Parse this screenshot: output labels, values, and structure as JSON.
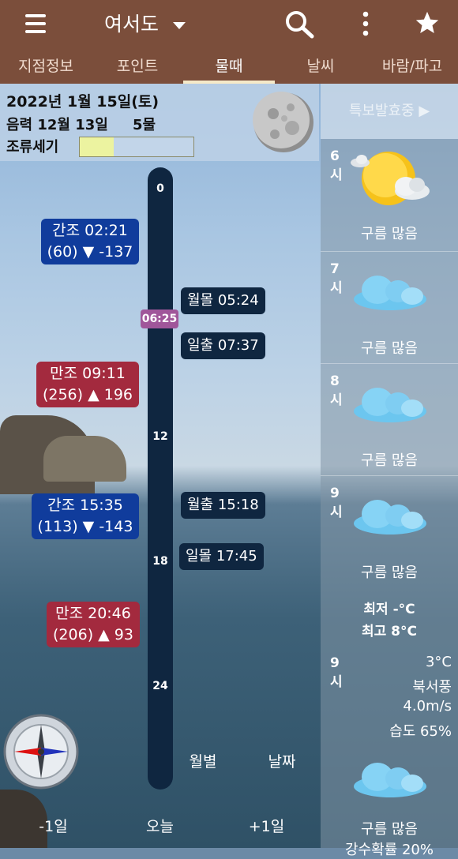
{
  "appbar": {
    "menu_icon": "menu-icon",
    "location": "여서도",
    "search_icon": "search-icon",
    "more_icon": "more-vert-icon",
    "star_icon": "star-icon"
  },
  "tabs": [
    {
      "label": "지점정보",
      "active": false
    },
    {
      "label": "포인트",
      "active": false
    },
    {
      "label": "물때",
      "active": true
    },
    {
      "label": "날씨",
      "active": false
    },
    {
      "label": "바람/파고",
      "active": false
    }
  ],
  "info": {
    "date": "2022년 1월 15일(토)",
    "lunar": "음력 12월 13일",
    "mul": "5물",
    "tide_strength_label": "조류세기",
    "tide_strength_level": 0.3
  },
  "warning_label": "특보발효중 ▶",
  "timeline": {
    "ticks": [
      "0",
      "12",
      "18",
      "24"
    ],
    "now": "06:25"
  },
  "tides": [
    {
      "line1": "간조 02:21",
      "line2": "(60) ▼ -137",
      "kind": "low"
    },
    {
      "line1": "만조 09:11",
      "line2": "(256) ▲ 196",
      "kind": "high"
    },
    {
      "line1": "간조 15:35",
      "line2": "(113) ▼ -143",
      "kind": "low"
    },
    {
      "line1": "만조 20:46",
      "line2": "(206) ▲ 93",
      "kind": "high"
    }
  ],
  "sun_moon": [
    {
      "label": "월몰 05:24"
    },
    {
      "label": "일출 07:37"
    },
    {
      "label": "월출 15:18"
    },
    {
      "label": "일몰 17:45"
    }
  ],
  "bottom": {
    "monthly": "월별",
    "date": "날짜",
    "prev": "-1일",
    "today": "오늘",
    "next": "+1일"
  },
  "hours": [
    {
      "h": "6",
      "unit": "시",
      "cond": "구름 많음",
      "icon": "sun-cloud-icon"
    },
    {
      "h": "7",
      "unit": "시",
      "cond": "구름 많음",
      "icon": "cloud-icon"
    },
    {
      "h": "8",
      "unit": "시",
      "cond": "구름 많음",
      "icon": "cloud-icon"
    },
    {
      "h": "9",
      "unit": "시",
      "cond": "구름 많음",
      "icon": "cloud-icon"
    }
  ],
  "minmax": {
    "min": "최저 -°C",
    "max": "최고 8°C"
  },
  "current": {
    "h": "9",
    "unit": "시",
    "temp": "3°C",
    "wind_dir": "북서풍",
    "wind_speed": "4.0m/s",
    "humidity": "습도 65%",
    "cond": "구름 많음",
    "rain": "강수확률 20%"
  },
  "colors": {
    "appbar": "#7b4e3b",
    "low_tide": "#103c9c",
    "high_tide": "#a32a3e",
    "timeline": "#0f2640",
    "now_marker": "#a0569a",
    "strength_fill": "#ecf3a0"
  }
}
